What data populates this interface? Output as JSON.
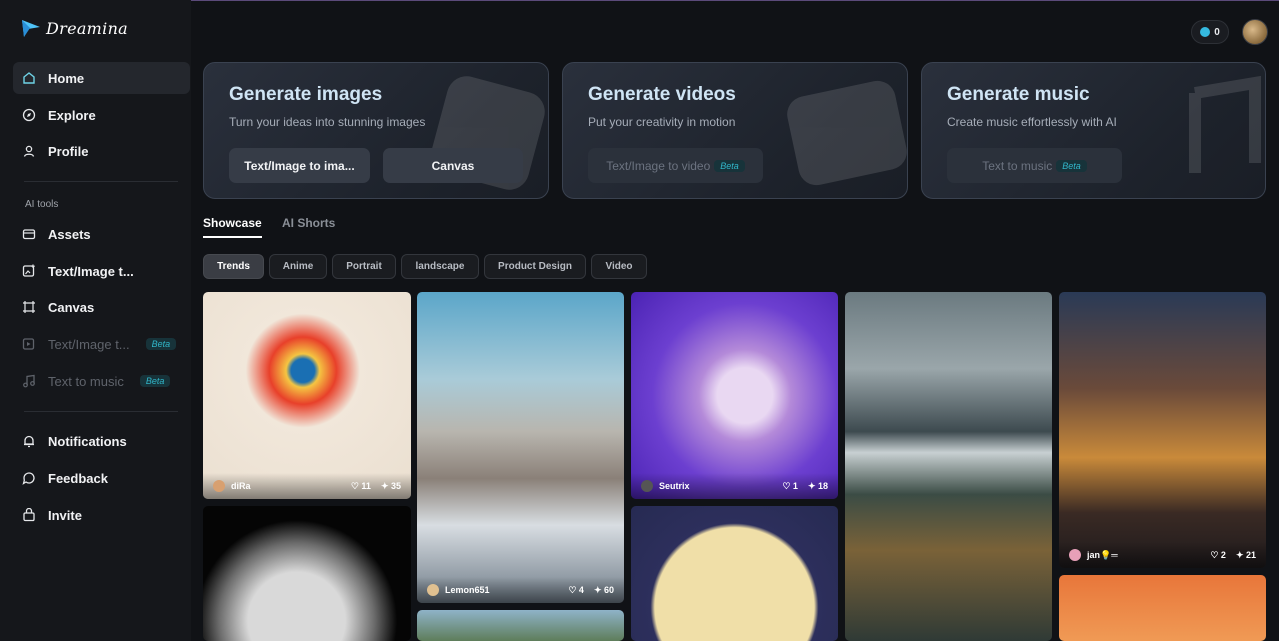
{
  "brand": {
    "name": "Dreamina"
  },
  "sidebar": {
    "nav": [
      {
        "label": "Home",
        "icon": "home-icon"
      },
      {
        "label": "Explore",
        "icon": "compass-icon"
      },
      {
        "label": "Profile",
        "icon": "user-icon"
      }
    ],
    "ai_tools_label": "AI tools",
    "tools": [
      {
        "label": "Assets",
        "icon": "folder-icon"
      },
      {
        "label": "Text/Image t...",
        "icon": "image-add-icon"
      },
      {
        "label": "Canvas",
        "icon": "canvas-icon"
      },
      {
        "label": "Text/Image t...",
        "icon": "video-add-icon",
        "badge": "Beta"
      },
      {
        "label": "Text to music",
        "icon": "music-icon",
        "badge": "Beta"
      }
    ],
    "footer": [
      {
        "label": "Notifications",
        "icon": "bell-icon"
      },
      {
        "label": "Feedback",
        "icon": "chat-icon"
      },
      {
        "label": "Invite",
        "icon": "gift-icon"
      }
    ]
  },
  "header": {
    "credits": "0"
  },
  "cards": [
    {
      "title": "Generate images",
      "subtitle": "Turn your ideas into stunning images",
      "buttons": [
        "Text/Image to ima...",
        "Canvas"
      ]
    },
    {
      "title": "Generate videos",
      "subtitle": "Put your creativity in motion",
      "buttons": [
        "Text/Image to video"
      ],
      "badge": "Beta"
    },
    {
      "title": "Generate music",
      "subtitle": "Create music effortlessly with AI",
      "buttons": [
        "Text to music"
      ],
      "badge": "Beta"
    }
  ],
  "tabs": [
    "Showcase",
    "AI Shorts"
  ],
  "filters": [
    "Trends",
    "Anime",
    "Portrait",
    "landscape",
    "Product Design",
    "Video"
  ],
  "gallery": [
    {
      "user": "diRa",
      "likes": "11",
      "remix": "35"
    },
    {
      "user": "Lemon651",
      "likes": "4",
      "remix": "60"
    },
    {
      "user": "Seutrix",
      "likes": "1",
      "remix": "18"
    },
    {
      "user": "jan💡═",
      "likes": "2",
      "remix": "21"
    }
  ]
}
